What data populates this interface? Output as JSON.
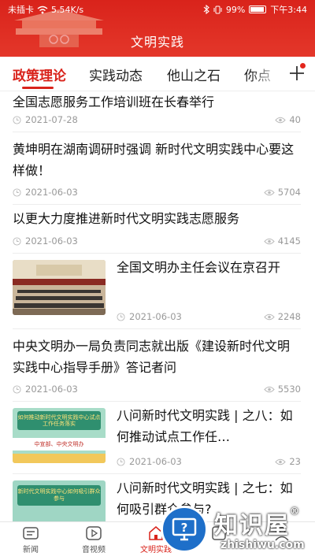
{
  "status_bar": {
    "carrier": "未插卡",
    "speed": "5.54K/s",
    "battery": "99%",
    "time": "下午3:44"
  },
  "header": {
    "title": "文明实践"
  },
  "tabs": [
    {
      "label": "政策理论",
      "active": true
    },
    {
      "label": "实践动态"
    },
    {
      "label": "他山之石"
    },
    {
      "label": "你点"
    }
  ],
  "articles": [
    {
      "title": "全国志愿服务工作培训班在长春举行",
      "date": "2021-07-28",
      "views": "40"
    },
    {
      "title": "黄坤明在湖南调研时强调  新时代文明实践中心要这样做！",
      "date": "2021-06-03",
      "views": "5704"
    },
    {
      "title": "以更大力度推进新时代文明实践志愿服务",
      "date": "2021-06-03",
      "views": "4145"
    },
    {
      "title": "全国文明办主任会议在京召开",
      "date": "2021-06-03",
      "views": "2248",
      "thumb": "meeting-photo"
    },
    {
      "title": "中央文明办一局负责同志就出版《建设新时代文明实践中心指导手册》答记者问",
      "date": "2021-06-03",
      "views": "5530"
    },
    {
      "title": "八问新时代文明实践  |  之八：如何推动试点工作任…",
      "date": "2021-06-03",
      "views": "23",
      "thumb": "poster-green",
      "thumb_caption": "如何推动新时代文明实践中心试点工作任务落实",
      "thumb_sub": "中宣部、中央文明办"
    },
    {
      "title": "八问新时代文明实践  |  之七：如何吸引群众参与?",
      "thumb": "poster-green",
      "thumb_caption": "新时代文明实践中心如何吸引群众参与"
    }
  ],
  "bottom_nav": [
    {
      "label": "新闻",
      "icon": "news-icon"
    },
    {
      "label": "音视频",
      "icon": "video-icon"
    },
    {
      "label": "文明实践",
      "icon": "home-icon",
      "active": true
    },
    {
      "label": "",
      "icon": "service-icon"
    },
    {
      "label": "",
      "icon": "user-icon"
    }
  ],
  "watermark": {
    "text": "知识屋",
    "sub": "zhishiwu.com",
    "reg": "®"
  },
  "colors": {
    "brand_red": "#d9231b",
    "meta_gray": "#999999",
    "divider": "#ededed"
  }
}
